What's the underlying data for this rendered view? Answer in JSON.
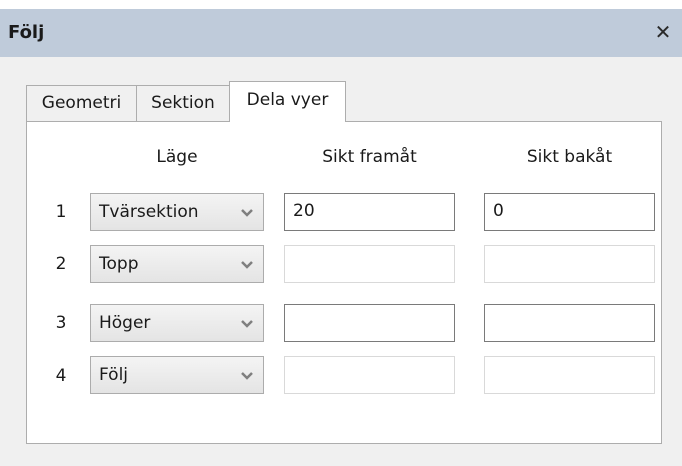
{
  "window": {
    "title": "Följ",
    "close_glyph": "✕"
  },
  "tabs": [
    {
      "label": "Geometri",
      "active": false
    },
    {
      "label": "Sektion",
      "active": false
    },
    {
      "label": "Dela vyer",
      "active": true
    }
  ],
  "columns": {
    "mode": "Läge",
    "forward": "Sikt framåt",
    "backward": "Sikt bakåt"
  },
  "rows": [
    {
      "num": "1",
      "mode": "Tvärsektion",
      "forward": "20",
      "backward": "0",
      "forward_enabled": true,
      "backward_enabled": true
    },
    {
      "num": "2",
      "mode": "Topp",
      "forward": "",
      "backward": "",
      "forward_enabled": false,
      "backward_enabled": false
    },
    {
      "num": "3",
      "mode": "Höger",
      "forward": "",
      "backward": "",
      "forward_enabled": true,
      "backward_enabled": true
    },
    {
      "num": "4",
      "mode": "Följ",
      "forward": "",
      "backward": "",
      "forward_enabled": false,
      "backward_enabled": false
    }
  ],
  "icons": {
    "close": "close-icon",
    "dropdown": "chevron-down-icon"
  },
  "colors": {
    "titlebar": "#bfcbda",
    "dialog_bg": "#f0f0f0",
    "panel_bg": "#ffffff",
    "border": "#adadad",
    "arrow": "#7f7f7f"
  }
}
